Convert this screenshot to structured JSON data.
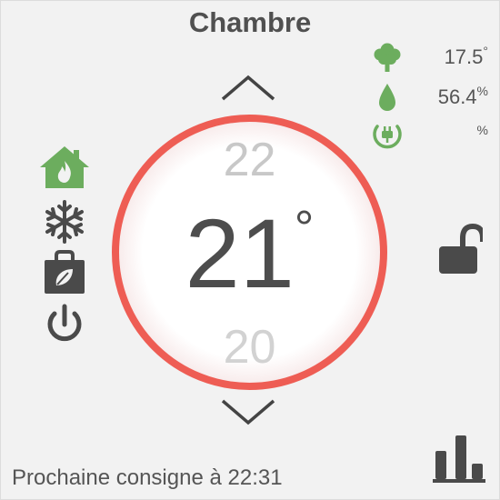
{
  "room": {
    "title": "Chambre"
  },
  "readings": {
    "temperature": {
      "value": "17.5",
      "unit": "°",
      "icon": "tree-icon"
    },
    "humidity": {
      "value": "56.4",
      "unit": "%",
      "icon": "water-drop-icon"
    },
    "power": {
      "value": "",
      "unit": "%",
      "icon": "plug-icon"
    }
  },
  "modes": [
    {
      "name": "comfort",
      "icon": "home-flame-icon",
      "active": true
    },
    {
      "name": "frost-protection",
      "icon": "snowflake-icon",
      "active": false
    },
    {
      "name": "eco",
      "icon": "eco-bag-icon",
      "active": false
    },
    {
      "name": "off",
      "icon": "power-icon",
      "active": false
    }
  ],
  "setpoint": {
    "above": "22",
    "current": "21",
    "degree_symbol": "°",
    "below": "20"
  },
  "lock": {
    "icon": "unlocked-padlock-icon",
    "state": "unlocked"
  },
  "footer": {
    "next_setpoint": "Prochaine consigne à 22:31"
  },
  "chart_button": {
    "icon": "bar-chart-icon"
  },
  "colors": {
    "accent_ring": "#ee5d54",
    "green": "#6cad5e",
    "dark_icon": "#4a4a4a"
  }
}
